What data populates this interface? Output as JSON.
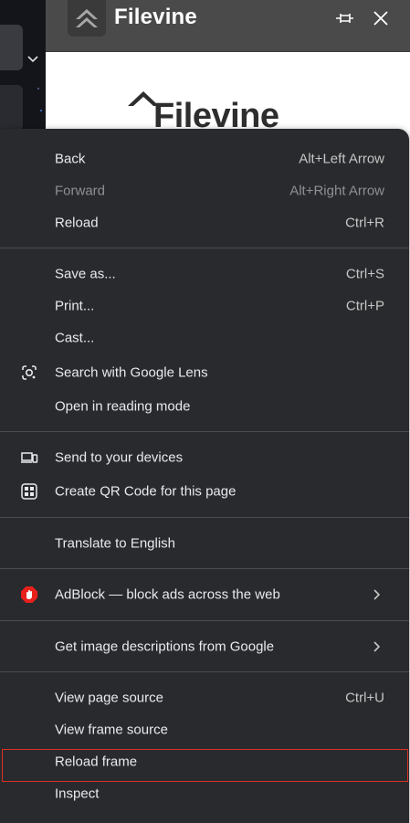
{
  "app": {
    "title": "Filevine",
    "content_logo_text": "Filevine"
  },
  "menu": {
    "group1": [
      {
        "label": "Back",
        "shortcut": "Alt+Left Arrow",
        "disabled": false
      },
      {
        "label": "Forward",
        "shortcut": "Alt+Right Arrow",
        "disabled": true
      },
      {
        "label": "Reload",
        "shortcut": "Ctrl+R",
        "disabled": false
      }
    ],
    "group2": [
      {
        "label": "Save as...",
        "shortcut": "Ctrl+S"
      },
      {
        "label": "Print...",
        "shortcut": "Ctrl+P"
      },
      {
        "label": "Cast...",
        "shortcut": ""
      },
      {
        "label": "Search with Google Lens",
        "shortcut": "",
        "icon": "google-lens-icon"
      },
      {
        "label": "Open in reading mode",
        "shortcut": ""
      }
    ],
    "group3": [
      {
        "label": "Send to your devices",
        "icon": "devices-icon"
      },
      {
        "label": "Create QR Code for this page",
        "icon": "qr-code-icon"
      }
    ],
    "group4": [
      {
        "label": "Translate to English"
      }
    ],
    "group5": [
      {
        "label": "AdBlock — block ads across the web",
        "icon": "adblock-icon",
        "submenu": true
      }
    ],
    "group6": [
      {
        "label": "Get image descriptions from Google",
        "submenu": true
      }
    ],
    "group7": [
      {
        "label": "View page source",
        "shortcut": "Ctrl+U"
      },
      {
        "label": "View frame source",
        "shortcut": ""
      },
      {
        "label": "Reload frame",
        "shortcut": "",
        "highlighted": true
      },
      {
        "label": "Inspect",
        "shortcut": ""
      }
    ]
  },
  "colors": {
    "menu_bg": "#292a2d",
    "highlight_border": "#d93025",
    "adblock_red": "#e8201c",
    "header_bg": "#4a4a4b"
  }
}
